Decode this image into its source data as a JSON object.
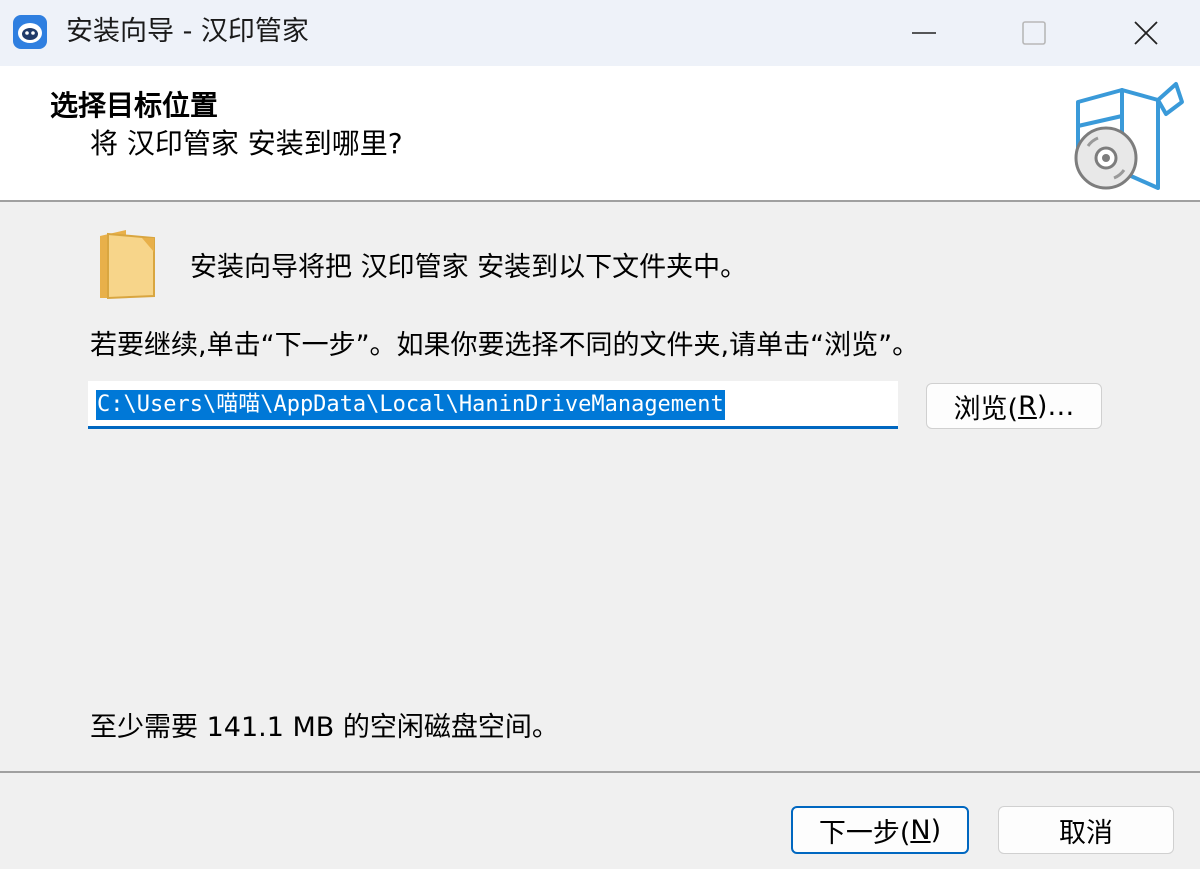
{
  "window": {
    "title": "安装向导 - 汉印管家",
    "icon": "app-logo-icon"
  },
  "header": {
    "title": "选择目标位置",
    "subtitle": "将 汉印管家 安装到哪里?"
  },
  "body": {
    "intro": "安装向导将把 汉印管家 安装到以下文件夹中。",
    "instruction": "若要继续,单击“下一步”。如果你要选择不同的文件夹,请单击“浏览”。",
    "install_path": "C:\\Users\\喵喵\\AppData\\Local\\HaninDriveManagement",
    "browse_label_pre": "浏览(",
    "browse_mnemonic": "R",
    "browse_label_post": ")…",
    "disk_space": "至少需要 141.1 MB 的空闲磁盘空间。"
  },
  "footer": {
    "next_label_pre": "下一步(",
    "next_mnemonic": "N",
    "next_label_post": ")",
    "cancel_label": "取消"
  },
  "colors": {
    "accent": "#0067c0",
    "selection": "#0078d7",
    "titlebar": "#eef2f9"
  }
}
